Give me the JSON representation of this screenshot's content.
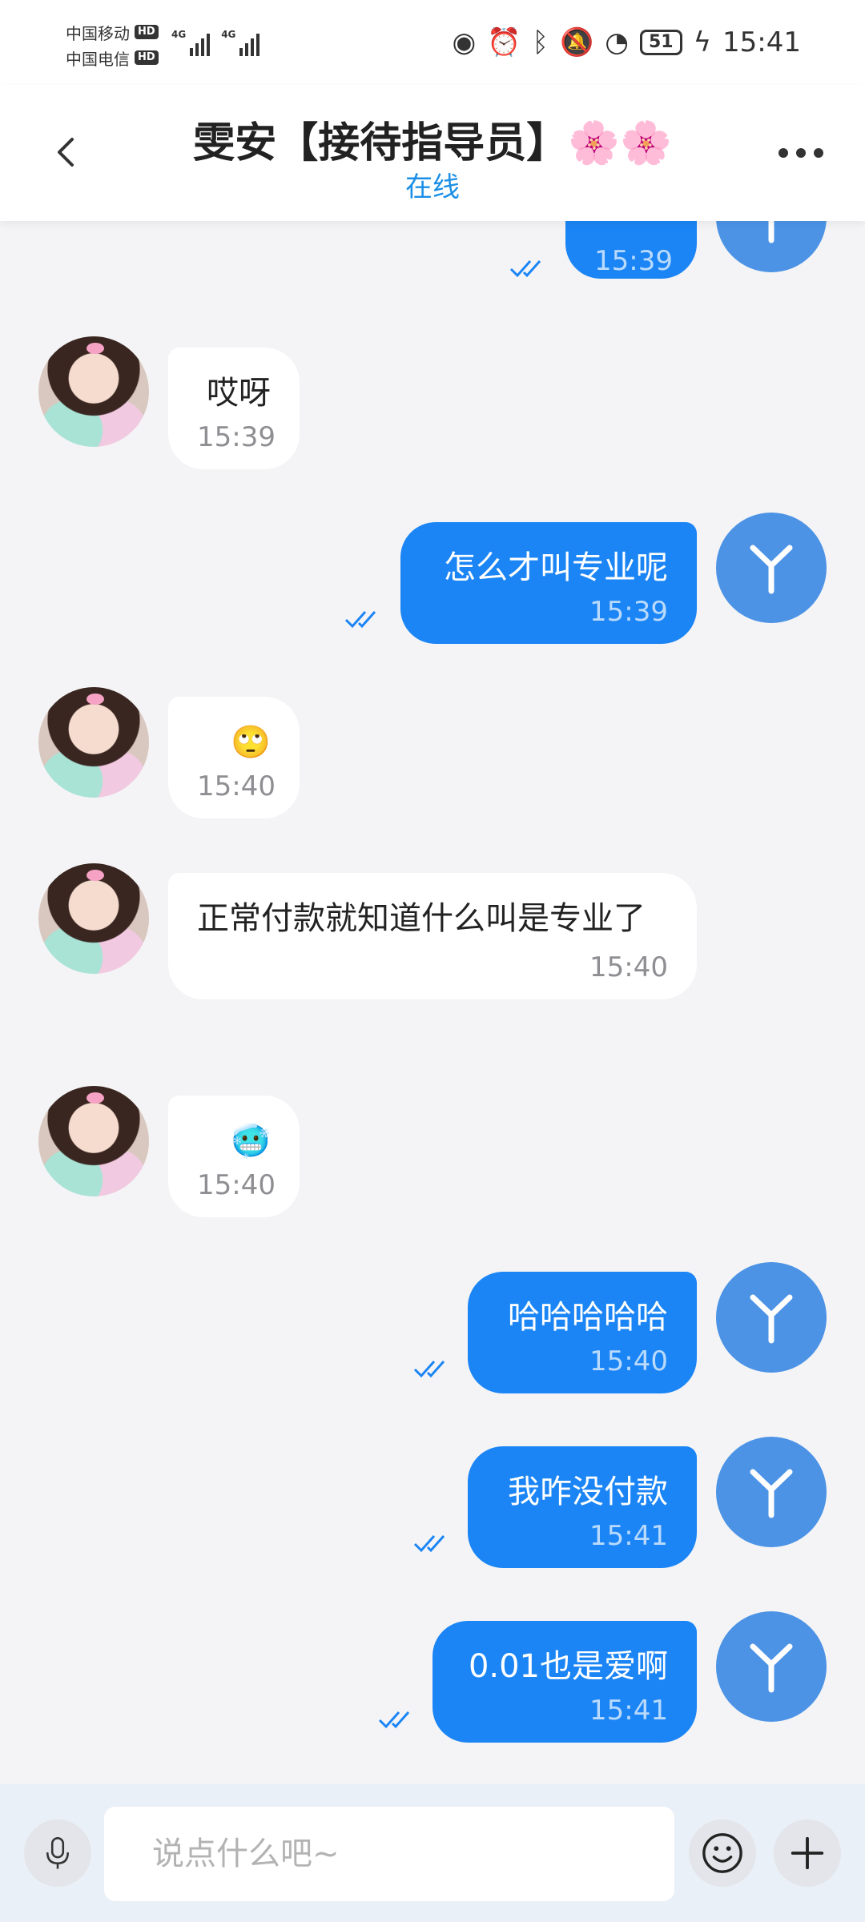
{
  "status_bar": {
    "carrier_1": "中国移动",
    "carrier_2": "中国电信",
    "hd_badge": "HD",
    "network_1": "4G",
    "network_2": "4G",
    "battery": "51",
    "time": "15:41"
  },
  "header": {
    "title": "雯安【接待指导员】🌸🌸",
    "status": "在线",
    "back_icon": "chevron-left-icon",
    "more_icon": "more-dots-icon"
  },
  "messages": [
    {
      "from": "me",
      "text": "",
      "time": "15:39",
      "read": true
    },
    {
      "from": "contact",
      "text": "哎呀",
      "time": "15:39"
    },
    {
      "from": "me",
      "text": "怎么才叫专业呢",
      "time": "15:39",
      "read": true
    },
    {
      "from": "contact",
      "text": "🙄",
      "time": "15:40"
    },
    {
      "from": "contact",
      "text": "正常付款就知道什么叫是专业了",
      "time": "15:40"
    },
    {
      "from": "contact",
      "text": "🥶",
      "time": "15:40"
    },
    {
      "from": "me",
      "text": "哈哈哈哈哈",
      "time": "15:40",
      "read": true
    },
    {
      "from": "me",
      "text": "我咋没付款",
      "time": "15:41",
      "read": true
    },
    {
      "from": "me",
      "text": "0.01也是爱啊",
      "time": "15:41",
      "read": true
    }
  ],
  "input_bar": {
    "placeholder": "说点什么吧~",
    "mic_icon": "microphone-icon",
    "emoji_icon": "smiley-icon",
    "add_icon": "plus-icon"
  },
  "colors": {
    "accent": "#1b85f5",
    "online": "#1b8fe7",
    "my_avatar": "#4c93e6",
    "background": "#f4f4f6"
  }
}
